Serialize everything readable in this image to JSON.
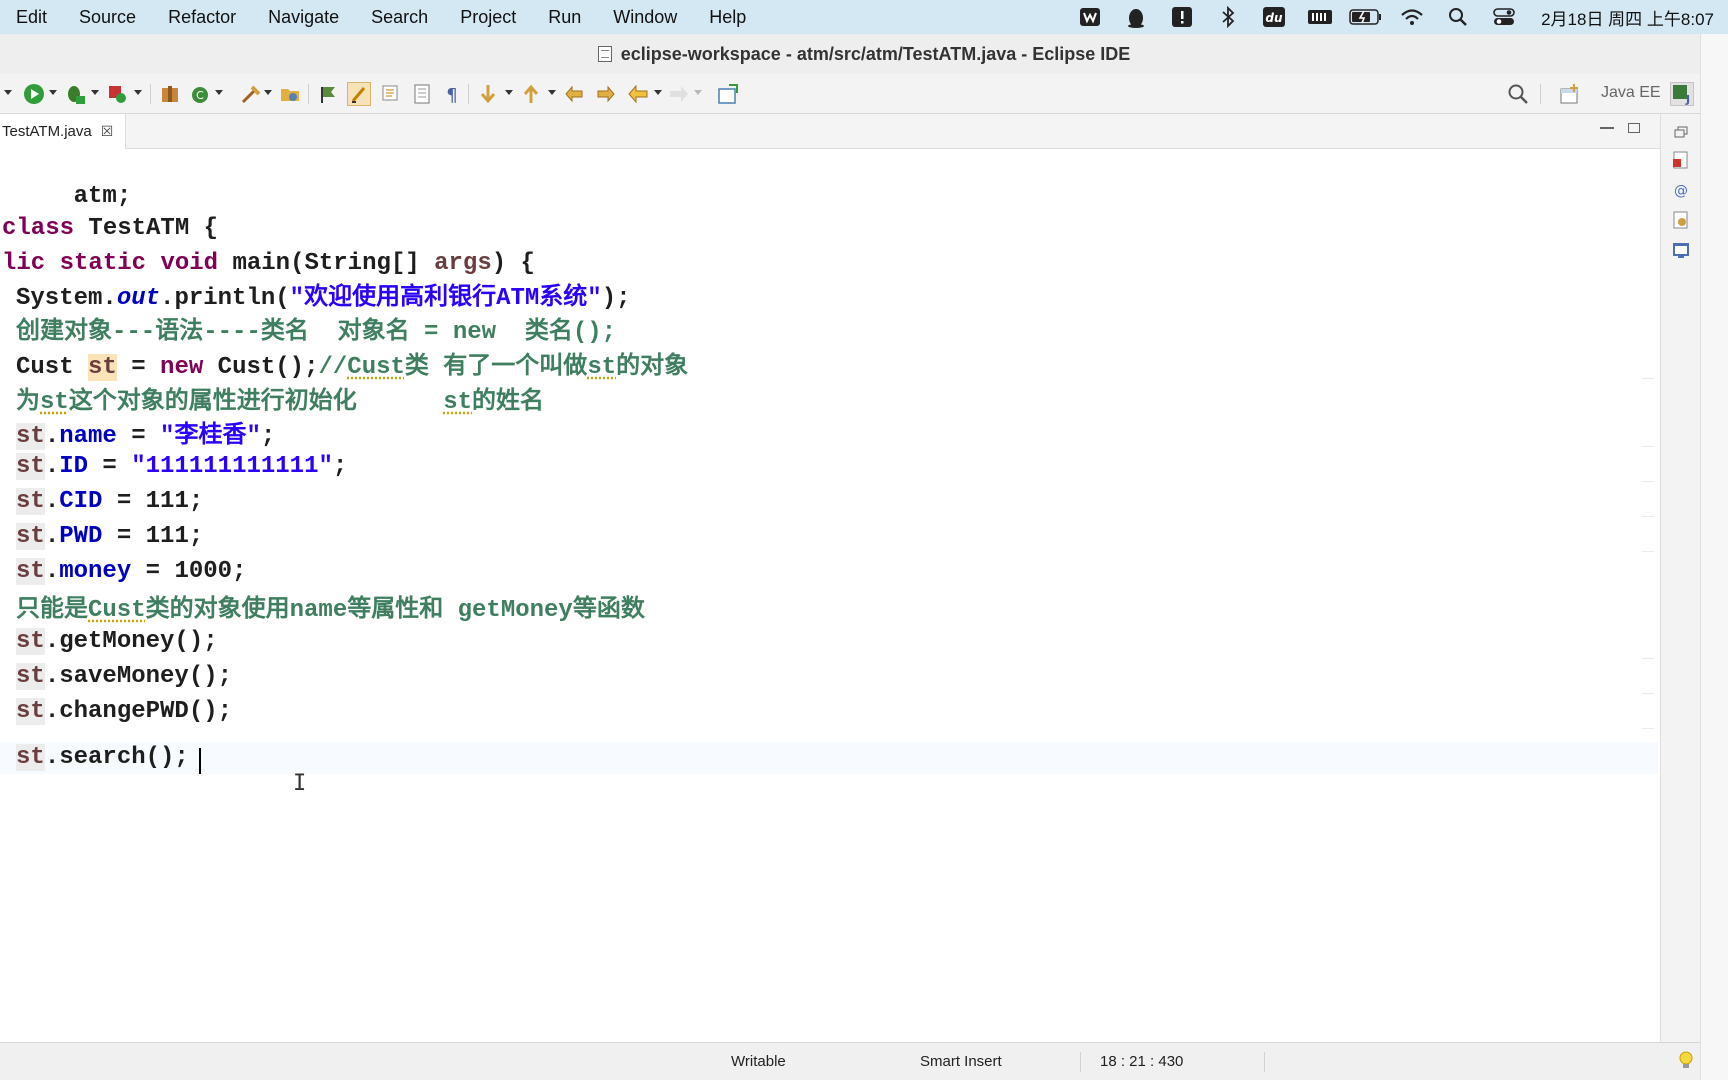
{
  "menubar": {
    "items": [
      "Edit",
      "Source",
      "Refactor",
      "Navigate",
      "Search",
      "Project",
      "Run",
      "Window",
      "Help"
    ],
    "status_icons": [
      "wps-icon",
      "qq-penguin-icon",
      "alert-icon",
      "bluetooth-icon",
      "baidu-du-icon",
      "battery-cells-icon",
      "battery-charging-icon",
      "wifi-icon",
      "spotlight-search-icon",
      "control-center-icon"
    ],
    "baidu_label": "du",
    "clock": "2月18日 周四 上午8:07"
  },
  "window": {
    "title": "eclipse-workspace - atm/src/atm/TestATM.java - Eclipse IDE"
  },
  "toolbar": {
    "perspective": "Java EE"
  },
  "editor": {
    "tab_label": "TestATM.java",
    "tab_close": "☒",
    "code": {
      "line1": "atm;",
      "line2_kw": "class",
      "line2_rest": " TestATM {",
      "line3_a": "lic",
      "line3_b": "static",
      "line3_c": "void",
      "line3_rest": " main(String[] ",
      "line3_args": "args",
      "line3_end": ") {",
      "line4_a": "System.",
      "line4_out": "out",
      "line4_b": ".println(",
      "line4_str": "\"欢迎使用高利银行ATM系统\"",
      "line4_end": ");",
      "line5": "创建对象---语法----类名  对象名 = new  类名();",
      "line6_a": "Cust ",
      "line6_st": "st",
      "line6_b": " = ",
      "line6_new": "new",
      "line6_c": " Cust();",
      "line6_cmt1": "//",
      "line6_cust": "Cust",
      "line6_cmt2": "类 有了一个叫做",
      "line6_st2": "st",
      "line6_cmt3": "的对象",
      "line7_a": "为",
      "line7_st": "st",
      "line7_b": "这个对象的属性进行初始化      ",
      "line7_st2": "st",
      "line7_c": "的姓名",
      "st": "st",
      "line8_fld": "name",
      "line8_rest": " = ",
      "line8_str": "\"李桂香\"",
      "line8_end": ";",
      "line9_fld": "ID",
      "line9_rest": " = ",
      "line9_str": "\"111111111111\"",
      "line9_end": ";",
      "line10_fld": "CID",
      "line10_rest": " = 111;",
      "line11_fld": "PWD",
      "line11_rest": " = 111;",
      "line12_fld": "money",
      "line12_rest": " = 1000;",
      "line13_a": "只能是",
      "line13_cust": "Cust",
      "line13_b": "类的对象使用name等属性和 getMoney等函数",
      "line14": ".getMoney();",
      "line15": ".saveMoney();",
      "line16": ".changePWD();",
      "line17": ".search();",
      "ibeam": "I"
    }
  },
  "statusbar": {
    "mode": "Writable",
    "insert": "Smart Insert",
    "position": "18 : 21 : 430"
  },
  "colors": {
    "keyword": "#7f0055",
    "string": "#2a00ff",
    "comment": "#3f7f5f",
    "field": "#0000c0",
    "local_var": "#6a3e3e",
    "menubar_bg": "#d4e8f3"
  }
}
